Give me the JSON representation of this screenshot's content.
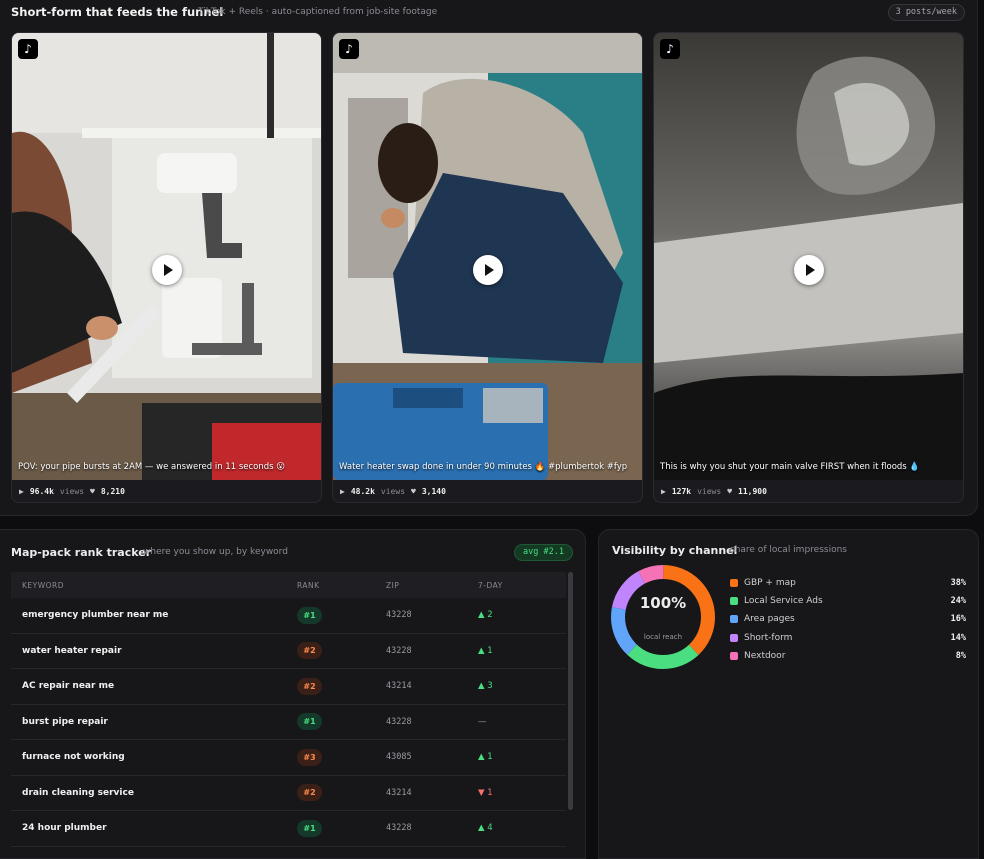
{
  "short_form": {
    "title": "Short-form that feeds the funnel",
    "subtitle": "TikTok + Reels · auto-captioned from job-site footage",
    "badge": "3 posts/week",
    "videos": [
      {
        "caption": "POV: your pipe bursts at 2AM — we answered in 11 seconds 😮",
        "views": "96.4k",
        "views_label": "views",
        "likes": "8,210"
      },
      {
        "caption": "Water heater swap done in under 90 minutes 🔥 #plumbertok #fyp",
        "views": "48.2k",
        "views_label": "views",
        "likes": "3,140"
      },
      {
        "caption": "This is why you shut your main valve FIRST when it floods 💧",
        "views": "127k",
        "views_label": "views",
        "likes": "11,900"
      }
    ]
  },
  "rank_tracker": {
    "title": "Map-pack rank tracker",
    "subtitle": "where you show up, by keyword",
    "avg": "avg #2.1",
    "columns": [
      "KEYWORD",
      "RANK",
      "ZIP",
      "7-DAY"
    ],
    "rows": [
      {
        "keyword": "emergency plumber near me",
        "rank": "#1",
        "zip": "43228",
        "change": "▲ 2"
      },
      {
        "keyword": "water heater repair",
        "rank": "#2",
        "zip": "43228",
        "change": "▲ 1"
      },
      {
        "keyword": "AC repair near me",
        "rank": "#2",
        "zip": "43214",
        "change": "▲ 3"
      },
      {
        "keyword": "burst pipe repair",
        "rank": "#1",
        "zip": "43228",
        "change": "—"
      },
      {
        "keyword": "furnace not working",
        "rank": "#3",
        "zip": "43085",
        "change": "▲ 1"
      },
      {
        "keyword": "drain cleaning service",
        "rank": "#2",
        "zip": "43214",
        "change": "▼ 1"
      },
      {
        "keyword": "24 hour plumber",
        "rank": "#1",
        "zip": "43228",
        "change": "▲ 4"
      }
    ]
  },
  "visibility": {
    "title": "Visibility by channel",
    "subtitle": "share of local impressions",
    "center_value": "100%",
    "center_label": "local reach",
    "channels": [
      {
        "name": "GBP + map",
        "pct": "38%",
        "value": 38,
        "color": "#f97316"
      },
      {
        "name": "Local Service Ads",
        "pct": "24%",
        "value": 24,
        "color": "#4ade80"
      },
      {
        "name": "Area pages",
        "pct": "16%",
        "value": 16,
        "color": "#60a5fa"
      },
      {
        "name": "Short-form",
        "pct": "14%",
        "value": 14,
        "color": "#c084fc"
      },
      {
        "name": "Nextdoor",
        "pct": "8%",
        "value": 8,
        "color": "#f472b6"
      }
    ]
  }
}
